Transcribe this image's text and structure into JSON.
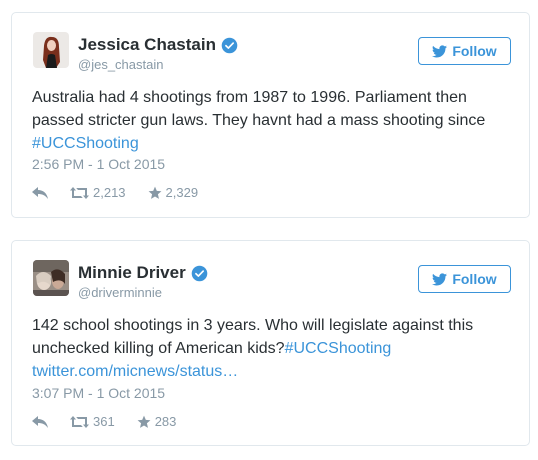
{
  "tweets": [
    {
      "name": "Jessica Chastain",
      "handle": "@jes_chastain",
      "follow_label": "Follow",
      "text_plain": "Australia had 4 shootings from 1987 to 1996. Parliament then passed stricter gun laws. They havnt had a mass shooting since ",
      "hashtag": "#UCCShooting",
      "timestamp": "2:56 PM - 1 Oct 2015",
      "retweets": "2,213",
      "favorites": "2,329"
    },
    {
      "name": "Minnie Driver",
      "handle": "@driverminnie",
      "follow_label": "Follow",
      "text_plain": "142 school shootings in 3 years. Who will legislate against this unchecked killing of American kids?",
      "hashtag": "#UCCShooting",
      "link": "twitter.com/micnews/status…",
      "timestamp": "3:07 PM - 1 Oct 2015",
      "retweets": "361",
      "favorites": "283"
    }
  ],
  "colors": {
    "accent": "#3b94d9",
    "muted": "#8899a6",
    "text": "#292f33",
    "border": "#e1e8ed"
  },
  "icons": [
    "verified-icon",
    "twitter-bird-icon",
    "reply-icon",
    "retweet-icon",
    "favorite-star-icon"
  ]
}
